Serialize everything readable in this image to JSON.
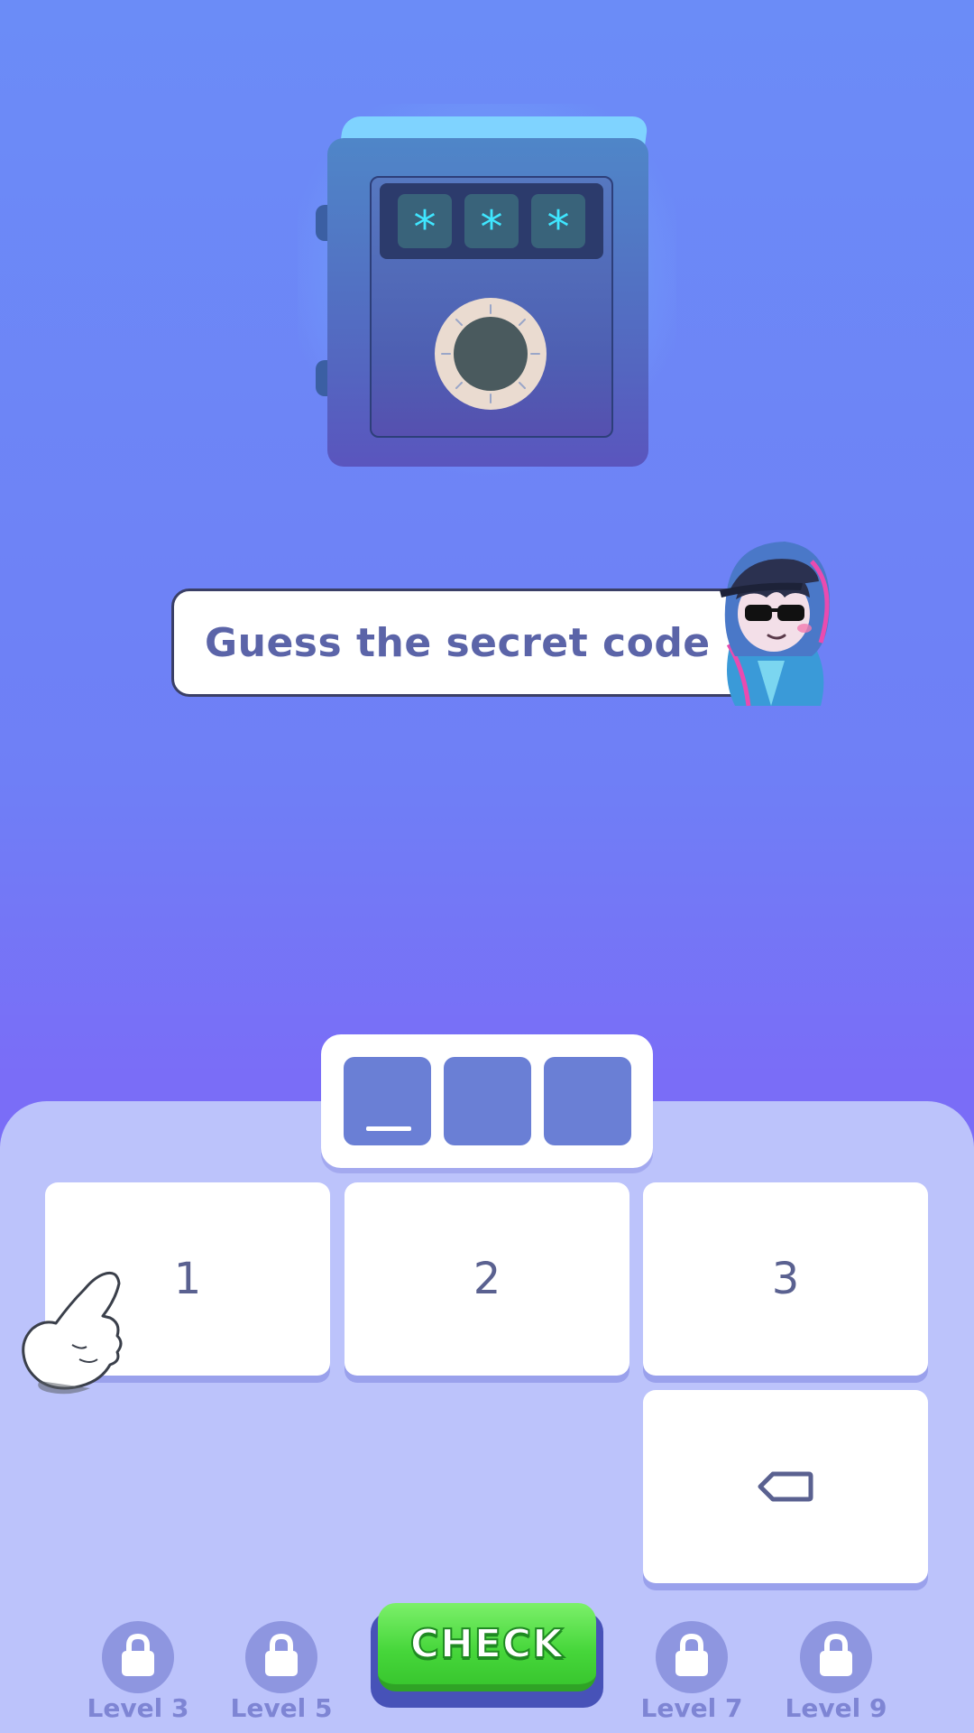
{
  "safe": {
    "code_digits": [
      "*",
      "*",
      "*"
    ]
  },
  "bubble": {
    "text": "Guess the secret code"
  },
  "code_input": {
    "slots": [
      "",
      "",
      ""
    ],
    "active_slot": 1
  },
  "keypad": {
    "key_1": "1",
    "key_2": "2",
    "key_3": "3",
    "backspace_icon": "backspace-icon"
  },
  "levels": [
    {
      "label": "Level 3",
      "icon": "lock-icon"
    },
    {
      "label": "Level 5",
      "icon": "lock-icon"
    },
    {
      "label": "Level 7",
      "icon": "lock-icon"
    },
    {
      "label": "Level 9",
      "icon": "lock-icon"
    }
  ],
  "check_button": {
    "label": "CHECK"
  },
  "colors": {
    "background_top": "#6b8cf7",
    "background_bottom": "#7b70f5",
    "panel": "#bcc3fb",
    "slot": "#6a7fd5",
    "check_green": "#46d63a",
    "code_cyan": "#3fe6ff"
  }
}
